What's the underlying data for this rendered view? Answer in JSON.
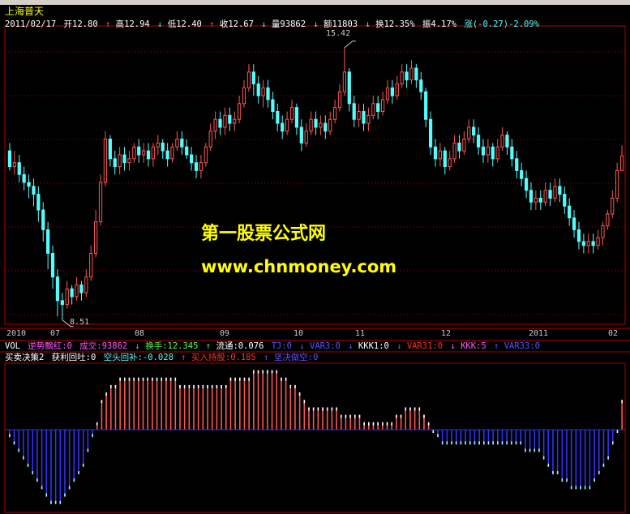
{
  "header": {
    "title": "上海普天",
    "date": "2011/02/17",
    "open": "开12.80",
    "high": "高12.94",
    "low": "低12.40",
    "close": "收12.67",
    "volume": "量93862",
    "amount": "额11803",
    "turnover": "换12.35%",
    "amplitude": "振4.17%",
    "change": "涨(-0.27)-2.09%"
  },
  "annotations": {
    "max": "15.42",
    "min": "8.51"
  },
  "watermark": {
    "line1": "第一股票公式网",
    "line2": "www.chnmoney.com"
  },
  "time_axis": [
    "2010",
    "07",
    "08",
    "09",
    "10",
    "11",
    "12",
    "2011",
    "02"
  ],
  "volume_panel": {
    "name": "VOL",
    "items": [
      "逆势飘红:0",
      "成交:93862",
      "换手:12.345",
      "流通:0.076",
      "TJ:0",
      "VAR3:0",
      "KKK1:0",
      "VAR31:0",
      "KKK:5",
      "VAR33:0"
    ]
  },
  "indicator_panel": {
    "name": "买卖决策2",
    "items": [
      "获利回吐:0",
      "空头回补:-0.028",
      "买入持股:0.185",
      "坚决做空:0"
    ]
  },
  "colors": {
    "up": "#ff5555",
    "down": "#54fcfc",
    "grid": "#b00000",
    "title": "#ffff00",
    "white": "#ffffff",
    "magenta": "#ff55ff",
    "green": "#55ff55",
    "blue": "#5555ff",
    "red": "#ff3030",
    "bar_blue": "#3030ff"
  },
  "chart_data": {
    "type": "candlestick",
    "y_range": [
      8.4,
      15.6
    ],
    "max_price": 15.42,
    "min_price": 8.51,
    "indicator_range": [
      -0.105,
      0.085
    ],
    "candles": [
      [
        12.8,
        12.4,
        13.0,
        12.3
      ],
      [
        12.4,
        12.5,
        12.8,
        12.2
      ],
      [
        12.5,
        12.2,
        12.7,
        12.0
      ],
      [
        12.2,
        12.0,
        12.4,
        11.8
      ],
      [
        12.0,
        11.9,
        12.2,
        11.6
      ],
      [
        11.9,
        11.7,
        12.1,
        11.4
      ],
      [
        11.7,
        11.3,
        11.9,
        11.0
      ],
      [
        11.3,
        10.8,
        11.5,
        10.5
      ],
      [
        10.8,
        10.2,
        11.0,
        9.8
      ],
      [
        10.2,
        9.6,
        10.4,
        9.3
      ],
      [
        9.6,
        9.0,
        9.8,
        8.6
      ],
      [
        9.0,
        8.9,
        9.2,
        8.51
      ],
      [
        8.9,
        9.3,
        9.5,
        8.8
      ],
      [
        9.3,
        9.1,
        9.4,
        8.9
      ],
      [
        9.1,
        9.4,
        9.6,
        9.0
      ],
      [
        9.4,
        9.2,
        9.5,
        9.0
      ],
      [
        9.2,
        9.6,
        9.8,
        9.1
      ],
      [
        9.6,
        10.2,
        10.4,
        9.5
      ],
      [
        10.2,
        11.0,
        11.3,
        10.1
      ],
      [
        11.0,
        12.0,
        12.2,
        10.9
      ],
      [
        12.0,
        13.1,
        13.3,
        11.9
      ],
      [
        13.1,
        12.6,
        13.2,
        12.4
      ],
      [
        12.6,
        12.4,
        12.8,
        12.2
      ],
      [
        12.4,
        12.7,
        12.9,
        12.2
      ],
      [
        12.7,
        12.5,
        12.9,
        12.3
      ],
      [
        12.5,
        12.6,
        12.8,
        12.3
      ],
      [
        12.6,
        12.9,
        13.0,
        12.5
      ],
      [
        12.9,
        12.7,
        13.1,
        12.5
      ],
      [
        12.7,
        12.8,
        13.0,
        12.5
      ],
      [
        12.8,
        12.6,
        13.0,
        12.4
      ],
      [
        12.6,
        12.9,
        13.0,
        12.4
      ],
      [
        12.9,
        13.0,
        13.2,
        12.7
      ],
      [
        13.0,
        12.8,
        13.1,
        12.6
      ],
      [
        12.8,
        12.6,
        13.0,
        12.4
      ],
      [
        12.6,
        12.9,
        13.0,
        12.5
      ],
      [
        12.9,
        13.1,
        13.3,
        12.8
      ],
      [
        13.1,
        12.9,
        13.3,
        12.7
      ],
      [
        12.9,
        12.7,
        13.1,
        12.6
      ],
      [
        12.7,
        12.5,
        12.9,
        12.3
      ],
      [
        12.5,
        12.3,
        12.7,
        12.1
      ],
      [
        12.3,
        12.5,
        12.7,
        12.1
      ],
      [
        12.5,
        12.9,
        13.0,
        12.4
      ],
      [
        12.9,
        13.3,
        13.5,
        12.8
      ],
      [
        13.3,
        13.6,
        13.8,
        13.1
      ],
      [
        13.6,
        13.4,
        13.8,
        13.2
      ],
      [
        13.4,
        13.7,
        13.9,
        13.2
      ],
      [
        13.7,
        13.5,
        13.9,
        13.3
      ],
      [
        13.5,
        13.6,
        13.8,
        13.3
      ],
      [
        13.6,
        14.0,
        14.2,
        13.5
      ],
      [
        14.0,
        14.4,
        14.6,
        13.9
      ],
      [
        14.4,
        14.8,
        15.0,
        14.3
      ],
      [
        14.8,
        14.5,
        15.0,
        14.2
      ],
      [
        14.5,
        14.2,
        14.7,
        14.0
      ],
      [
        14.2,
        14.4,
        14.6,
        13.9
      ],
      [
        14.4,
        14.1,
        14.6,
        13.9
      ],
      [
        14.1,
        13.8,
        14.3,
        13.6
      ],
      [
        13.8,
        13.5,
        14.0,
        13.3
      ],
      [
        13.5,
        13.3,
        13.7,
        13.1
      ],
      [
        13.3,
        13.6,
        13.8,
        13.2
      ],
      [
        13.6,
        13.9,
        14.1,
        13.5
      ],
      [
        13.9,
        13.4,
        14.0,
        13.2
      ],
      [
        13.4,
        13.0,
        13.6,
        12.8
      ],
      [
        13.0,
        13.3,
        13.5,
        12.9
      ],
      [
        13.3,
        13.6,
        13.8,
        13.2
      ],
      [
        13.6,
        13.4,
        13.8,
        13.2
      ],
      [
        13.4,
        13.5,
        13.7,
        13.2
      ],
      [
        13.5,
        13.3,
        13.7,
        13.1
      ],
      [
        13.3,
        13.6,
        13.8,
        13.2
      ],
      [
        13.6,
        13.9,
        14.1,
        13.5
      ],
      [
        13.9,
        14.3,
        14.5,
        13.8
      ],
      [
        14.3,
        14.8,
        15.42,
        14.2
      ],
      [
        14.8,
        14.0,
        14.9,
        13.8
      ],
      [
        14.0,
        13.6,
        14.2,
        13.4
      ],
      [
        13.6,
        13.8,
        14.0,
        13.4
      ],
      [
        13.8,
        13.5,
        14.0,
        13.3
      ],
      [
        13.5,
        13.7,
        13.9,
        13.3
      ],
      [
        13.7,
        14.0,
        14.2,
        13.6
      ],
      [
        14.0,
        13.8,
        14.2,
        13.6
      ],
      [
        13.8,
        14.1,
        14.3,
        13.7
      ],
      [
        14.1,
        14.4,
        14.6,
        14.0
      ],
      [
        14.4,
        14.2,
        14.6,
        14.0
      ],
      [
        14.2,
        14.5,
        14.7,
        14.1
      ],
      [
        14.5,
        14.8,
        15.0,
        14.4
      ],
      [
        14.8,
        14.6,
        15.0,
        14.4
      ],
      [
        14.6,
        14.9,
        15.1,
        14.5
      ],
      [
        14.9,
        14.6,
        15.0,
        14.4
      ],
      [
        14.6,
        14.3,
        14.8,
        14.1
      ],
      [
        14.3,
        13.6,
        14.4,
        13.4
      ],
      [
        13.6,
        12.9,
        13.8,
        12.7
      ],
      [
        12.9,
        12.6,
        13.1,
        12.4
      ],
      [
        12.6,
        12.8,
        13.0,
        12.4
      ],
      [
        12.8,
        12.4,
        12.9,
        12.2
      ],
      [
        12.4,
        12.6,
        12.8,
        12.3
      ],
      [
        12.6,
        13.0,
        13.2,
        12.5
      ],
      [
        13.0,
        12.8,
        13.2,
        12.6
      ],
      [
        12.8,
        13.1,
        13.3,
        12.7
      ],
      [
        13.1,
        13.4,
        13.6,
        13.0
      ],
      [
        13.4,
        13.2,
        13.6,
        13.0
      ],
      [
        13.2,
        12.9,
        13.4,
        12.7
      ],
      [
        12.9,
        12.7,
        13.1,
        12.5
      ],
      [
        12.7,
        12.9,
        13.1,
        12.5
      ],
      [
        12.9,
        12.6,
        13.0,
        12.4
      ],
      [
        12.6,
        12.9,
        13.1,
        12.5
      ],
      [
        12.9,
        13.2,
        13.4,
        12.8
      ],
      [
        13.2,
        12.9,
        13.3,
        12.7
      ],
      [
        12.9,
        12.6,
        13.1,
        12.4
      ],
      [
        12.6,
        12.3,
        12.8,
        12.1
      ],
      [
        12.3,
        12.1,
        12.5,
        11.9
      ],
      [
        12.1,
        11.8,
        12.3,
        11.6
      ],
      [
        11.8,
        11.5,
        12.0,
        11.3
      ],
      [
        11.5,
        11.6,
        11.8,
        11.3
      ],
      [
        11.6,
        11.5,
        11.8,
        11.3
      ],
      [
        11.5,
        11.8,
        12.0,
        11.4
      ],
      [
        11.8,
        11.6,
        12.0,
        11.4
      ],
      [
        11.6,
        11.9,
        12.1,
        11.5
      ],
      [
        11.9,
        11.7,
        12.1,
        11.5
      ],
      [
        11.7,
        11.4,
        11.9,
        11.2
      ],
      [
        11.4,
        11.1,
        11.6,
        10.9
      ],
      [
        11.1,
        10.8,
        11.3,
        10.6
      ],
      [
        10.8,
        10.5,
        11.0,
        10.3
      ],
      [
        10.5,
        10.4,
        10.7,
        10.2
      ],
      [
        10.4,
        10.5,
        10.7,
        10.2
      ],
      [
        10.5,
        10.4,
        10.7,
        10.2
      ],
      [
        10.4,
        10.6,
        10.8,
        10.3
      ],
      [
        10.6,
        10.9,
        11.0,
        10.4
      ],
      [
        10.9,
        11.2,
        11.3,
        10.8
      ],
      [
        11.2,
        11.6,
        11.8,
        11.1
      ],
      [
        11.6,
        12.3,
        12.5,
        11.5
      ],
      [
        12.3,
        12.67,
        12.94,
        12.4
      ]
    ],
    "indicator": [
      -0.01,
      -0.02,
      -0.03,
      -0.04,
      -0.05,
      -0.06,
      -0.07,
      -0.08,
      -0.09,
      -0.1,
      -0.1,
      -0.1,
      -0.09,
      -0.08,
      -0.07,
      -0.06,
      -0.05,
      -0.03,
      -0.01,
      0.01,
      0.04,
      0.05,
      0.06,
      0.06,
      0.07,
      0.07,
      0.07,
      0.07,
      0.07,
      0.07,
      0.07,
      0.07,
      0.07,
      0.07,
      0.07,
      0.07,
      0.07,
      0.06,
      0.06,
      0.06,
      0.06,
      0.06,
      0.06,
      0.06,
      0.06,
      0.06,
      0.06,
      0.06,
      0.07,
      0.07,
      0.07,
      0.07,
      0.07,
      0.08,
      0.08,
      0.08,
      0.08,
      0.08,
      0.08,
      0.07,
      0.07,
      0.06,
      0.06,
      0.05,
      0.04,
      0.03,
      0.03,
      0.03,
      0.03,
      0.03,
      0.03,
      0.03,
      0.02,
      0.02,
      0.02,
      0.02,
      0.02,
      0.01,
      0.01,
      0.01,
      0.01,
      0.01,
      0.01,
      0.01,
      0.02,
      0.02,
      0.03,
      0.03,
      0.03,
      0.03,
      0.02,
      0.01,
      0.0,
      -0.01,
      -0.02,
      -0.02,
      -0.02,
      -0.02,
      -0.02,
      -0.02,
      -0.02,
      -0.02,
      -0.02,
      -0.02,
      -0.02,
      -0.02,
      -0.02,
      -0.02,
      -0.02,
      -0.02,
      -0.02,
      -0.02,
      -0.03,
      -0.03,
      -0.03,
      -0.03,
      -0.04,
      -0.05,
      -0.06,
      -0.06,
      -0.07,
      -0.07,
      -0.08,
      -0.08,
      -0.08,
      -0.08,
      -0.08,
      -0.07,
      -0.06,
      -0.05,
      -0.04,
      -0.02,
      0.0,
      0.04
    ]
  }
}
